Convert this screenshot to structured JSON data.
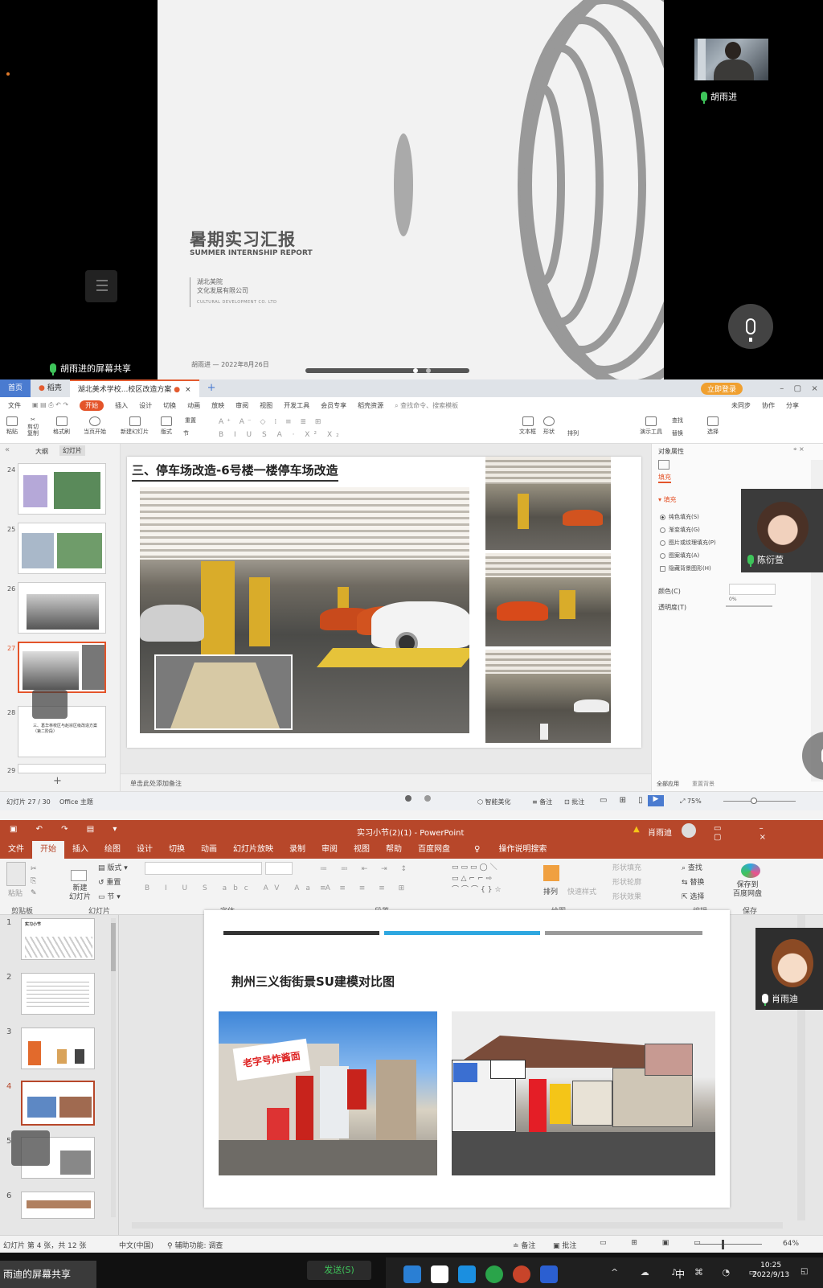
{
  "top_panel": {
    "presenter_name": "胡雨进",
    "share_label": "胡雨进的屏幕共享",
    "slide": {
      "title": "暑期实习汇报",
      "subtitle": "SUMMER INTERNSHIP REPORT",
      "company_line1": "湖北美院",
      "company_line2": "文化发展有限公司",
      "company_en": "CULTURAL DEVELOPMENT CO. LTD",
      "footer": "胡雨进 — 2022年8月26日"
    }
  },
  "wps": {
    "tabs": [
      {
        "label": "首页"
      },
      {
        "label": "稻壳"
      },
      {
        "label": "湖北美术学校...校区改造方案"
      }
    ],
    "login_label": "立即登录",
    "menu": [
      "文件",
      "开始",
      "插入",
      "设计",
      "切换",
      "动画",
      "放映",
      "审阅",
      "视图",
      "开发工具",
      "会员专享",
      "稻壳资源"
    ],
    "menu_active": "开始",
    "search_placeholder": "查找命令、搜索模板",
    "right_menu": [
      "未同步",
      "协作",
      "分享"
    ],
    "ribbon": [
      {
        "label": "粘贴"
      },
      {
        "label": "剪切"
      },
      {
        "label": "复制"
      },
      {
        "label": "格式刷"
      },
      {
        "label": "当页开始"
      },
      {
        "label": "新建幻灯片"
      },
      {
        "label": "版式"
      },
      {
        "label": "节"
      },
      {
        "label": "重置"
      },
      {
        "label": "文本框"
      },
      {
        "label": "形状"
      },
      {
        "label": "排列"
      },
      {
        "label": "演示工具"
      },
      {
        "label": "替换"
      },
      {
        "label": "选择"
      },
      {
        "label": "查找"
      }
    ],
    "side_tabs": [
      "大纲",
      "幻灯片"
    ],
    "slide_numbers": [
      "24",
      "25",
      "26",
      "27",
      "28",
      "29"
    ],
    "slide28_text": "三、葛华林校区与赵宗区级改造方案（第二阶段）",
    "slide_title": "三、停车场改造-6号楼一楼停车场改造",
    "notes_placeholder": "单击此处添加备注",
    "props": {
      "title": "对象属性",
      "tab": "填充",
      "section": "填充",
      "options": [
        "纯色填充(S)",
        "渐变填充(G)",
        "图片或纹理填充(P)",
        "图案填充(A)"
      ],
      "checkbox": "隐藏背景图形(H)",
      "color_label": "颜色(C)",
      "transparency_label": "透明度(T)",
      "transparency_value": "0%",
      "apply_all": "全部应用",
      "reset_bg": "重置背景"
    },
    "participant_name": "陈衍萱",
    "status": {
      "slide_count": "幻灯片 27 / 30",
      "theme": "Office 主题",
      "smart": "智能美化",
      "notes": "备注",
      "comments": "批注",
      "zoom": "75%"
    }
  },
  "ppt": {
    "title": "实习小节(2)(1)  -  PowerPoint",
    "user": "肖雨迪",
    "warning": "▲",
    "menu": [
      "文件",
      "开始",
      "插入",
      "绘图",
      "设计",
      "切换",
      "动画",
      "幻灯片放映",
      "录制",
      "审阅",
      "视图",
      "帮助",
      "百度网盘"
    ],
    "menu_active": "开始",
    "tell_me": "操作说明搜索",
    "ribbon_groups": [
      "剪贴板",
      "幻灯片",
      "字体",
      "段落",
      "绘图",
      "编辑",
      "保存"
    ],
    "ribbon_items": {
      "paste": "粘贴",
      "new_slide": "新建\n幻灯片",
      "layout": "版式",
      "reset": "重置",
      "section": "节",
      "arrange": "排列",
      "quick_styles": "快速样式",
      "shape_fill": "形状填充",
      "shape_outline": "形状轮廓",
      "shape_effects": "形状效果",
      "find": "查找",
      "replace": "替换",
      "select": "选择",
      "save_baidu": "保存到\n百度网盘"
    },
    "slide_numbers": [
      "1",
      "2",
      "3",
      "4",
      "5",
      "6"
    ],
    "thumb1_title": "实习小节",
    "slide_title": "荆州三义街街景SU建模对比图",
    "shop_sign": "老字号炸酱面",
    "participant_name": "肖雨迪",
    "status": {
      "slide_info": "幻灯片 第 4 张，共 12 张",
      "language": "中文(中国)",
      "accessibility": "辅助功能: 调查",
      "notes": "备注",
      "comments": "批注",
      "zoom": "64%"
    },
    "colors": {
      "accent": "#b7472a",
      "bar_dark": "#333333",
      "bar_blue": "#2ea7e0",
      "bar_gray": "#9a9a9a"
    }
  },
  "bottom": {
    "share_label": "雨迪的屏幕共享",
    "send_button": "发送(S)",
    "ime": "中",
    "time": "10:25",
    "date": "2022/9/13"
  }
}
